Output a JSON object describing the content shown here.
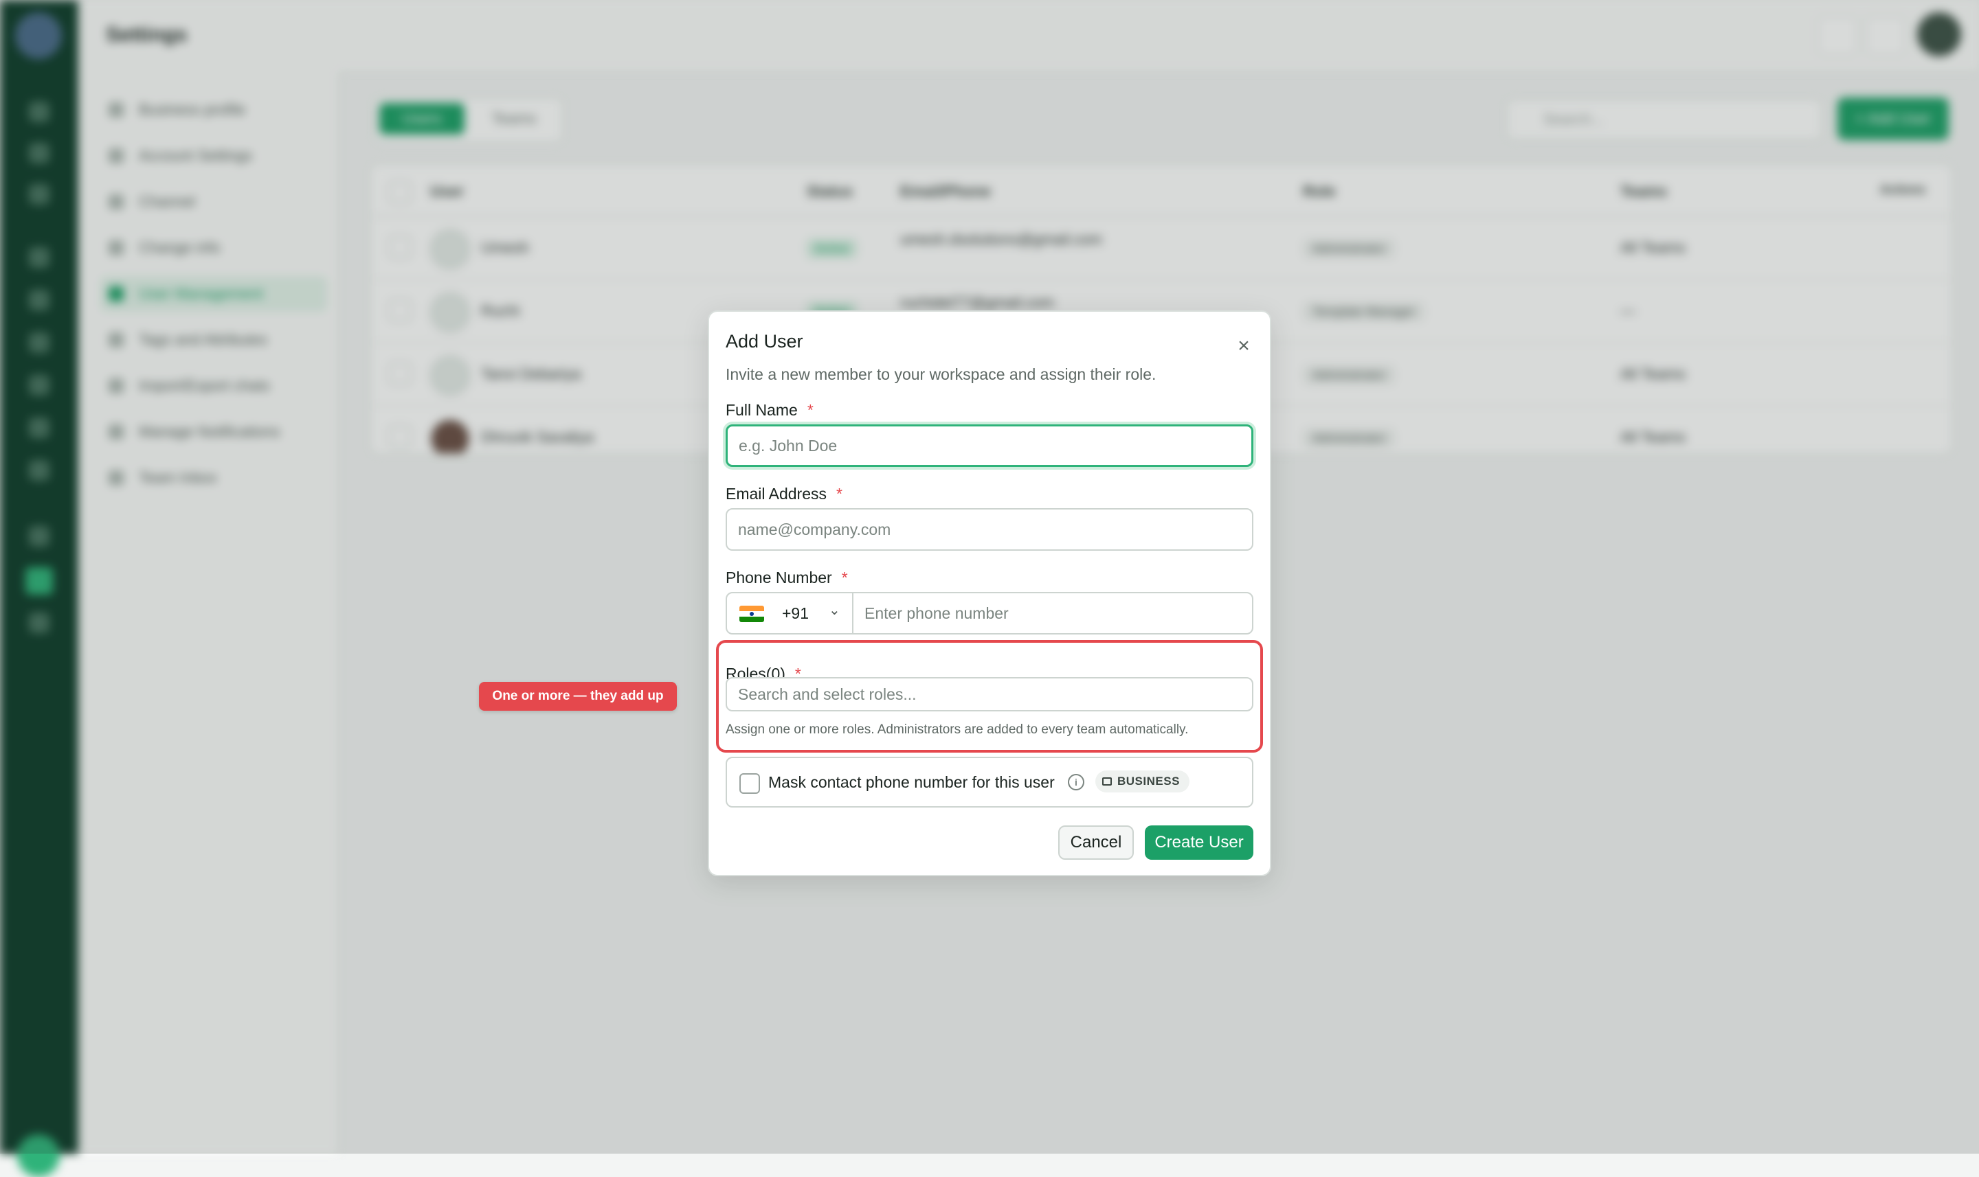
{
  "background": {
    "page_title": "Settings",
    "subnav": [
      {
        "label": "Business profile"
      },
      {
        "label": "Account Settings"
      },
      {
        "label": "Channel"
      },
      {
        "label": "Change info"
      },
      {
        "label": "User Management",
        "active": true
      },
      {
        "label": "Tags and Attributes"
      },
      {
        "label": "Import/Export chats"
      },
      {
        "label": "Manage Notifications"
      },
      {
        "label": "Team Inbox"
      }
    ],
    "tabs": {
      "users": "Users",
      "teams": "Teams"
    },
    "search_placeholder": "Search...",
    "add_user_label": "+ Add User",
    "table": {
      "headers": [
        "User",
        "Status",
        "Email/Phone",
        "Role",
        "Teams",
        "Actions"
      ],
      "rows": [
        {
          "name": "Umesh",
          "status": "Active",
          "email": "umesh.dsolutions@gmail.com",
          "role": "Administrator",
          "teams": "All Teams"
        },
        {
          "name": "Ruchi",
          "status": "Active",
          "email": "ruchidel77@gmail.com",
          "role": "Template Manager",
          "teams": "—"
        },
        {
          "name": "Tanvi Debariya",
          "status": "",
          "email": "",
          "role": "Administrator",
          "teams": "All Teams"
        },
        {
          "name": "Dhruvik Savaliya",
          "status": "",
          "email": "",
          "role": "Administrator",
          "teams": "All Teams"
        }
      ]
    }
  },
  "modal": {
    "title": "Add User",
    "subtitle": "Invite a new member to your workspace and assign their role.",
    "full_name": {
      "label": "Full Name",
      "placeholder": "e.g. John Doe"
    },
    "email": {
      "label": "Email Address",
      "placeholder": "name@company.com"
    },
    "phone": {
      "label": "Phone Number",
      "country_code": "+91",
      "placeholder": "Enter phone number"
    },
    "roles": {
      "label": "Roles(0)",
      "placeholder": "Search and select roles...",
      "hint": "Assign one or more roles. Administrators are added to every team automatically."
    },
    "mask": {
      "label": "Mask contact phone number for this user",
      "badge": "BUSINESS"
    },
    "required_mark": "*",
    "cancel_label": "Cancel",
    "create_label": "Create User",
    "close_glyph": "×"
  },
  "tooltip": {
    "text": "One or more — they add up"
  },
  "colors": {
    "accent": "#1ca067",
    "highlight": "#e5484d"
  }
}
